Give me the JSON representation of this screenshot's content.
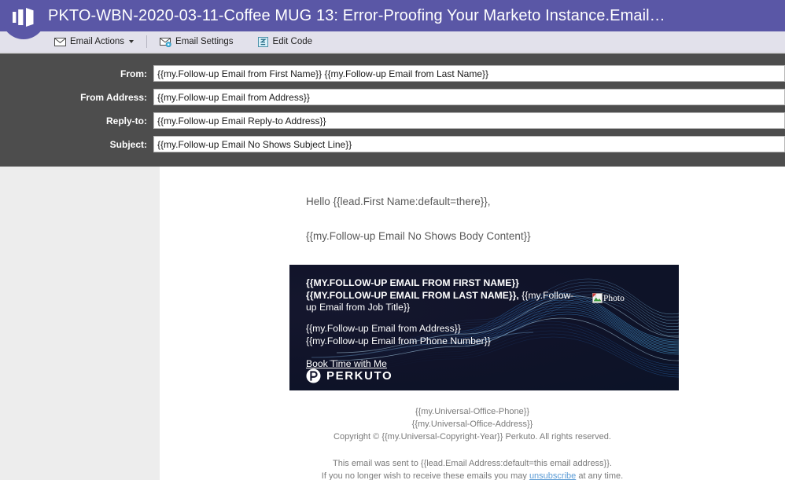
{
  "window": {
    "title": "PKTO-WBN-2020-03-11-Coffee MUG 13: Error-Proofing Your Marketo Instance.Email…",
    "brand_color": "#5a57a6"
  },
  "toolbar": {
    "items": [
      {
        "label": "Email Actions",
        "icon": "envelope-icon",
        "has_caret": true
      },
      {
        "label": "Email Settings",
        "icon": "envelope-gear-icon",
        "has_caret": false
      },
      {
        "label": "Edit Code",
        "icon": "code-window-icon",
        "has_caret": false
      }
    ]
  },
  "meta_fields": [
    {
      "label": "From:",
      "value": "{{my.Follow-up Email from First Name}} {{my.Follow-up Email from Last Name}}",
      "placeholder": ""
    },
    {
      "label": "From Address:",
      "value": "{{my.Follow-up Email from Address}}",
      "placeholder": ""
    },
    {
      "label": "Reply-to:",
      "value": "{{my.Follow-up Email Reply-to Address}}",
      "placeholder": ""
    },
    {
      "label": "Subject:",
      "value": "{{my.Follow-up Email No Shows Subject Line}}",
      "placeholder": ""
    }
  ],
  "email": {
    "greeting": "Hello {{lead.First Name:default=there}},",
    "body_token": "{{my.Follow-up Email No Shows Body Content}}",
    "signature": {
      "name_bold": "{{MY.FOLLOW-UP EMAIL FROM FIRST NAME}} {{MY.FOLLOW-UP EMAIL FROM LAST NAME}},",
      "name_rest": " {{my.Follow-up Email from Job Title}}",
      "address": "{{my.Follow-up Email from Address}}",
      "phone": "{{my.Follow-up Email from Phone Number}}",
      "cta": "Book Time with Me",
      "photo_alt": "Photo",
      "logo_text": "PERKUTO"
    },
    "footer": {
      "office_phone": "{{my.Universal-Office-Phone}}",
      "office_address": "{{my.Universal-Office-Address}}",
      "copyright": "Copyright © {{my.Universal-Copyright-Year}} Perkuto. All rights reserved.",
      "sent_to": "This email was sent to {{lead.Email Address:default=this email address}}.",
      "unsub_prefix": "If you no longer wish to receive these emails you may ",
      "unsub_link": "unsubscribe",
      "unsub_suffix": " at any time."
    }
  }
}
